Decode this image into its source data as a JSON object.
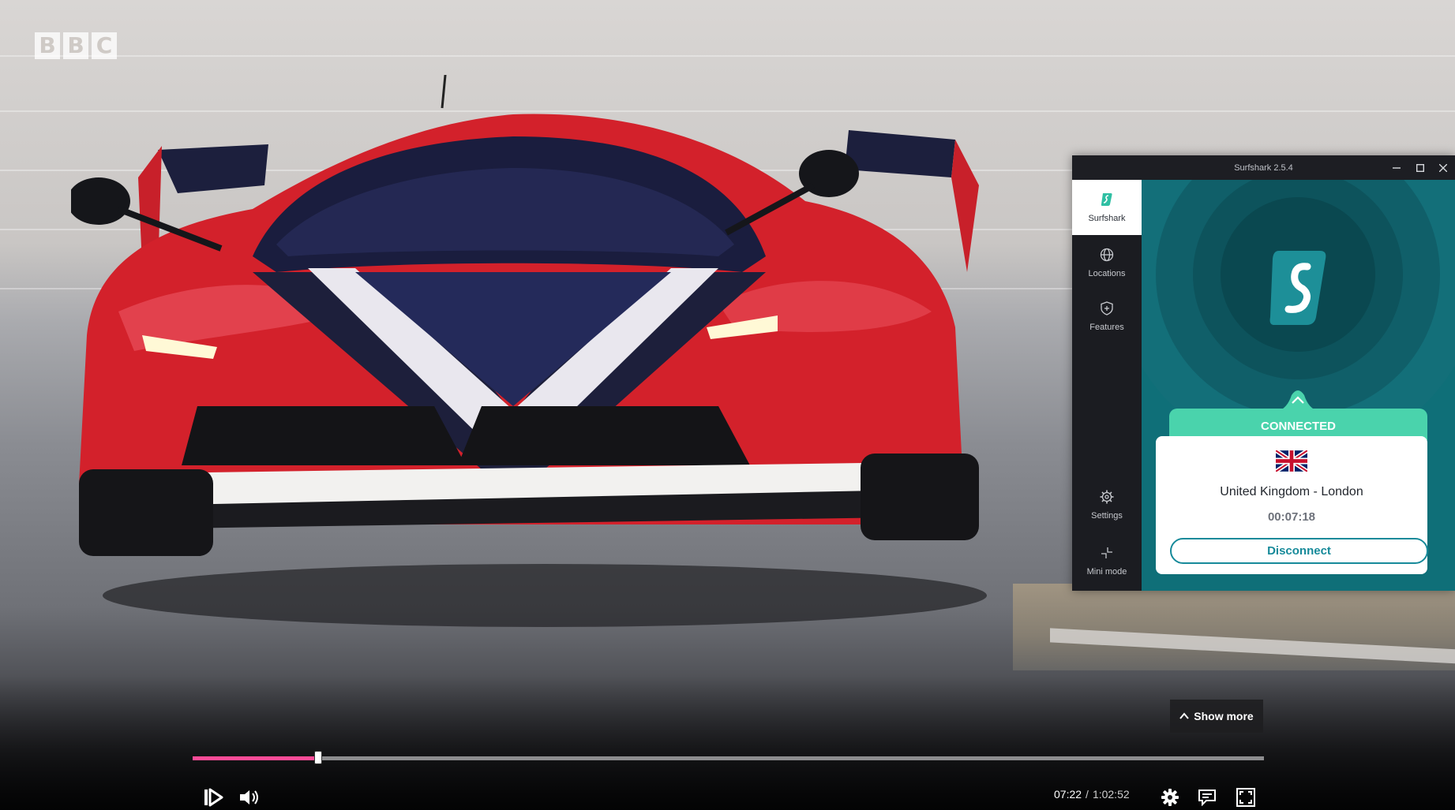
{
  "player": {
    "channel_logo": [
      "B",
      "B",
      "C"
    ],
    "show_more_label": "Show more",
    "progress": 0.117,
    "current_time": "07:22",
    "time_separator": "/",
    "duration": "1:02:52",
    "accent_color": "#ff4c98",
    "icons": [
      "play-pause-icon",
      "volume-icon",
      "settings-icon",
      "subtitles-icon",
      "fullscreen-icon"
    ]
  },
  "vpn": {
    "window_title": "Surfshark 2.5.4",
    "window_buttons": [
      "minimize-icon",
      "maximize-icon",
      "close-icon"
    ],
    "nav": [
      {
        "label": "Surfshark",
        "icon": "surfshark-logo-icon",
        "active": true
      },
      {
        "label": "Locations",
        "icon": "globe-icon",
        "active": false
      },
      {
        "label": "Features",
        "icon": "shield-plus-icon",
        "active": false
      },
      {
        "label": "Settings",
        "icon": "gear-icon",
        "active": false
      },
      {
        "label": "Mini mode",
        "icon": "mini-mode-icon",
        "active": false
      }
    ],
    "status": "CONNECTED",
    "location": "United Kingdom - London",
    "flag": "uk-flag-icon",
    "connection_time": "00:07:18",
    "disconnect_label": "Disconnect",
    "colors": {
      "teal": "#0f6f78",
      "connected": "#4ad3ac",
      "button": "#178a9a"
    }
  }
}
